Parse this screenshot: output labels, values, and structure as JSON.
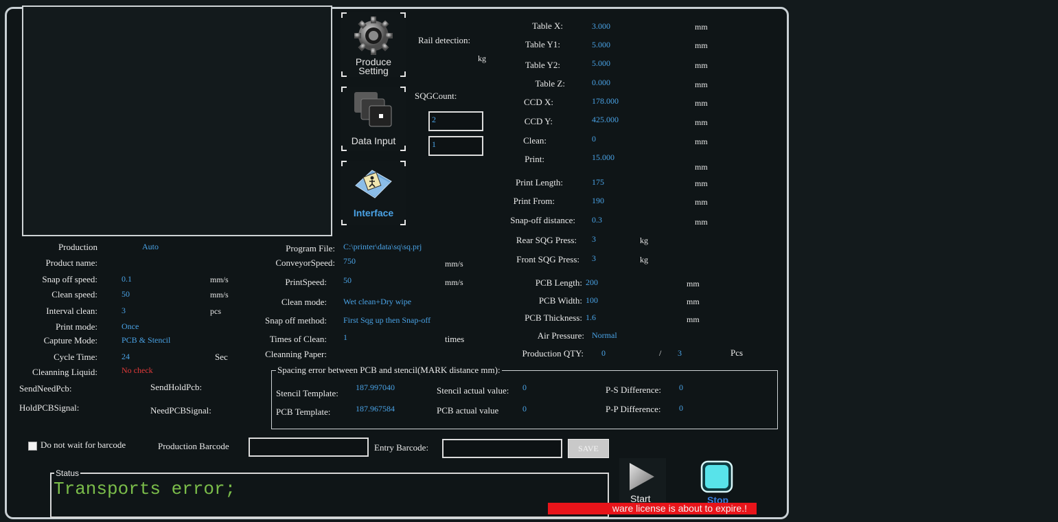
{
  "buttons": {
    "produce_setting": "Produce\nSetting",
    "data_input": "Data Input",
    "interface": "Interface",
    "save": "SAVE",
    "start": "Start",
    "stop": "Stop"
  },
  "rail": {
    "label": "Rail detection:",
    "unit": "kg"
  },
  "sqg": {
    "label": "SQGCount:",
    "box1": "2",
    "box2": "1"
  },
  "axes": [
    {
      "label": "Table X:",
      "value": "3.000",
      "unit": "mm"
    },
    {
      "label": "Table Y1:",
      "value": "5.000",
      "unit": "mm"
    },
    {
      "label": "Table Y2:",
      "value": "5.000",
      "unit": "mm"
    },
    {
      "label": "Table Z:",
      "value": "0.000",
      "unit": "mm"
    },
    {
      "label": "CCD X:",
      "value": "178.000",
      "unit": "mm"
    },
    {
      "label": "CCD Y:",
      "value": "425.000",
      "unit": "mm"
    },
    {
      "label": "Clean:",
      "value": "0",
      "unit": "mm"
    },
    {
      "label": "Print:",
      "value": "15.000",
      "unit": "mm"
    }
  ],
  "print_params": [
    {
      "label": "Print Length:",
      "value": "175",
      "unit": "mm"
    },
    {
      "label": "Print From:",
      "value": "190",
      "unit": "mm"
    },
    {
      "label": "Snap-off distance:",
      "value": "0.3",
      "unit": "mm"
    },
    {
      "label": "Rear SQG Press:",
      "value": "3",
      "unit": "kg"
    },
    {
      "label": "Front SQG Press:",
      "value": "3",
      "unit": "kg"
    }
  ],
  "pcb": [
    {
      "label": "PCB Length:",
      "value": "200",
      "unit": "mm"
    },
    {
      "label": "PCB Width:",
      "value": "100",
      "unit": "mm"
    },
    {
      "label": "PCB Thickness:",
      "value": "1.6",
      "unit": "mm"
    }
  ],
  "air": {
    "label": "Air Pressure:",
    "value": "Normal"
  },
  "qty": {
    "label": "Production QTY:",
    "done": "0",
    "sep": "/",
    "total": "3",
    "unit": "Pcs"
  },
  "left": {
    "production": {
      "label": "Production",
      "value": "Auto"
    },
    "product_name": {
      "label": "Product name:",
      "value": ""
    },
    "snap_speed": {
      "label": "Snap off speed:",
      "value": "0.1",
      "unit": "mm/s"
    },
    "clean_speed": {
      "label": "Clean speed:",
      "value": "50",
      "unit": "mm/s"
    },
    "interval_clean": {
      "label": "Interval clean:",
      "value": "3",
      "unit": "pcs"
    },
    "print_mode": {
      "label": "Print mode:",
      "value": "Once"
    },
    "capture_mode": {
      "label": "Capture Mode:",
      "value": "PCB & Stencil"
    },
    "cycle_time": {
      "label": "Cycle Time:",
      "value": "24",
      "unit": "Sec"
    },
    "cleaning_liquid": {
      "label": "Cleanning Liquid:",
      "value": "No check"
    },
    "send_need": "SendNeedPcb:",
    "send_hold": "SendHoldPcb:",
    "hold_signal": "HoldPCBSignal:",
    "need_signal": "NeedPCBSignal:"
  },
  "mid": {
    "program_file": {
      "label": "Program File:",
      "value": "C:\\printer\\data\\sq\\sq.prj"
    },
    "conveyor_speed": {
      "label": "ConveyorSpeed:",
      "value": "750",
      "unit": "mm/s"
    },
    "print_speed": {
      "label": "PrintSpeed:",
      "value": "50",
      "unit": "mm/s"
    },
    "clean_mode": {
      "label": "Clean mode:",
      "value": "Wet clean+Dry wipe"
    },
    "snap_method": {
      "label": "Snap off method:",
      "value": "First Sqg up then Snap-off"
    },
    "times_clean": {
      "label": "Times of Clean:",
      "value": "1",
      "unit": "times"
    },
    "cleaning_paper": {
      "label": "Cleanning Paper:",
      "value": ""
    }
  },
  "spacing": {
    "title": "Spacing error between PCB and stencil(MARK distance mm):",
    "stencil_template": {
      "label": "Stencil Template:",
      "value": "187.997040"
    },
    "pcb_template": {
      "label": "PCB Template:",
      "value": "187.967584"
    },
    "stencil_actual": {
      "label": "Stencil actual value:",
      "value": "0"
    },
    "pcb_actual": {
      "label": "PCB actual value",
      "value": "0"
    },
    "ps_diff": {
      "label": "P-S Difference:",
      "value": "0"
    },
    "pp_diff": {
      "label": "P-P Difference:",
      "value": "0"
    }
  },
  "barcode": {
    "no_wait": "Do not wait for barcode",
    "production_label": "Production Barcode",
    "entry_label": "Entry Barcode:"
  },
  "status": {
    "title": "Status",
    "text": "Transports error;"
  },
  "license": "ware license is about to expire.!",
  "colors": {
    "value": "#4aa3e6",
    "warning": "#e23a3a",
    "status": "#7bbd4a",
    "license_bg": "#e8141a"
  }
}
